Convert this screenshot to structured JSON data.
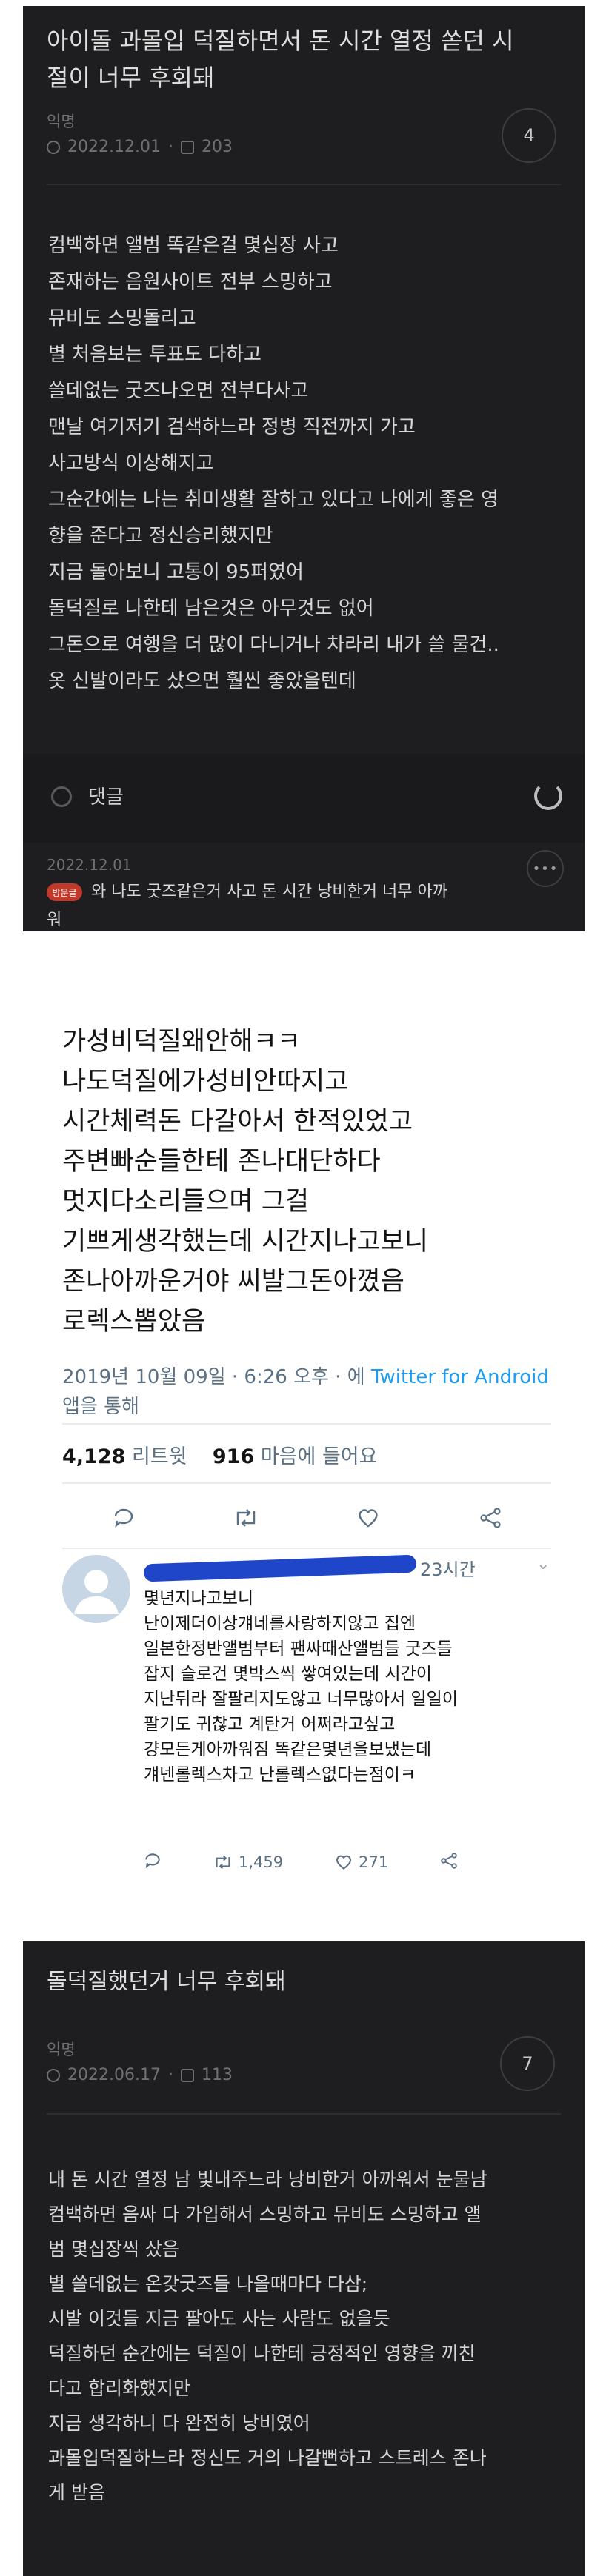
{
  "post1": {
    "title": "아이돌 과몰입 덕질하면서 돈 시간 열정 쏟던 시\n절이 너무 후회돼",
    "author": "익명",
    "date": "2022.12.01",
    "views": "203",
    "comment_count": "4",
    "body": "컴백하면 앨범 똑같은걸 몇십장 사고\n존재하는 음원사이트 전부 스밍하고\n뮤비도 스밍돌리고\n별 처음보는 투표도 다하고\n쓸데없는 굿즈나오면 전부다사고\n맨날 여기저기 검색하느라 정병 직전까지 가고\n사고방식 이상해지고\n그순간에는 나는 취미생활 잘하고 있다고 나에게 좋은 영\n향을 준다고 정신승리했지만\n지금 돌아보니 고통이 95퍼였어\n돌덕질로 나한테 남은것은 아무것도 없어\n그돈으로 여행을 더 많이 다니거나 차라리 내가 쓸 물건..\n옷 신발이라도 샀으면 훨씬 좋았을텐데",
    "comment_label": "댓글",
    "reply": {
      "date": "2022.12.01",
      "badge": "방문글",
      "text": "와 나도 굿즈같은거 사고 돈 시간 낭비한거 너무 아까",
      "text_cont": "워"
    }
  },
  "tweet": {
    "body": "가성비덕질왜안해ㅋㅋ\n나도덕질에가성비안따지고\n시간체력돈 다갈아서 한적있었고\n주변빠순들한테 존나대단하다\n멋지다소리들으며 그걸\n기쁘게생각했는데 시간지나고보니\n존나아까운거야 씨발그돈아꼈음\n로렉스뽑았음",
    "meta_date": "2019년 10월 09일 · 6:26 오후 · 에",
    "meta_link": "Twitter for Android",
    "meta_suffix": "앱을 통해",
    "retweets": "4,128",
    "retweets_label": "리트윗",
    "likes": "916",
    "likes_label": "마음에 들어요",
    "reply": {
      "time": "23시간",
      "text": "몇년지나고보니\n난이제더이상걔네를사랑하지않고 집엔\n일본한정반앨범부터 팬싸때산앨범들 굿즈들\n잡지 슬로건 몇박스씩 쌓여있는데 시간이\n지난뒤라 잘팔리지도않고 너무많아서 일일이\n팔기도 귀찮고 계탄거 어쩌라고싶고\n걍모든게아까워짐 똑같은몇년을보냈는데\n걔넨롤렉스차고 난롤렉스없다는점이ㅋ",
      "retweet_count": "1,459",
      "like_count": "271"
    }
  },
  "post3": {
    "title": "돌덕질했던거 너무 후회돼",
    "author": "익명",
    "date": "2022.06.17",
    "views": "113",
    "comment_count": "7",
    "body": "내 돈 시간 열정 남 빛내주느라 낭비한거 아까워서 눈물남\n컴백하면 음싸 다 가입해서 스밍하고 뮤비도 스밍하고 앨\n범 몇십장씩 샀음\n별 쓸데없는 온갖굿즈들 나올때마다 다삼;\n시발 이것들 지금 팔아도 사는 사람도 없을듯\n덕질하던 순간에는 덕질이 나한테 긍정적인 영향을 끼친\n다고 합리화했지만\n지금 생각하니 다 완전히 낭비였어\n과몰입덕질하느라 정신도 거의 나갈뻔하고 스트레스 존나\n게 받음"
  },
  "colors": {
    "dark_bg": "#1e1e20",
    "link_blue": "#1d9bf0",
    "scribble": "#1f45c8"
  }
}
